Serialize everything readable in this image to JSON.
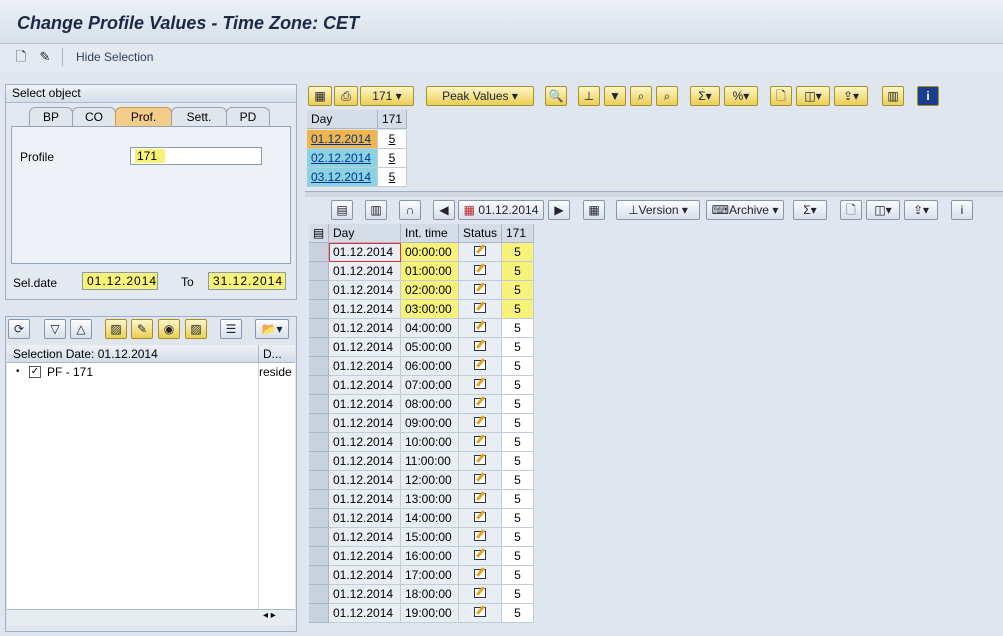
{
  "title": "Change Profile Values - Time Zone: CET",
  "appbar": {
    "hide_selection": "Hide Selection"
  },
  "select_object": {
    "header": "Select object",
    "tabs": [
      "BP",
      "CO",
      "Prof.",
      "Sett.",
      "PD"
    ],
    "active_tab": "Prof.",
    "profile_label": "Profile",
    "profile_value": "171",
    "seldate_label": "Sel.date",
    "seldate_value": "01.12.2014",
    "to_label": "To",
    "to_value": "31.12.2014"
  },
  "tree": {
    "col1": "Selection Date: 01.12.2014",
    "col2": "D...",
    "item": "PF - 171",
    "item_desc": "reside"
  },
  "top_toolbar": {
    "profile_btn": "171",
    "peak_values": "Peak Values"
  },
  "top_table": {
    "headers": [
      "Day",
      "171"
    ],
    "rows": [
      {
        "day": "01.12.2014",
        "value": "5"
      },
      {
        "day": "02.12.2014",
        "value": "5"
      },
      {
        "day": "03.12.2014",
        "value": "5"
      }
    ]
  },
  "bottom_toolbar": {
    "date_btn": "01.12.2014",
    "version": "Version",
    "archive": "Archive"
  },
  "bottom_table": {
    "headers": [
      "Day",
      "Int. time",
      "Status",
      "171"
    ],
    "rows": [
      {
        "day": "01.12.2014",
        "time": "00:00:00",
        "value": "5"
      },
      {
        "day": "01.12.2014",
        "time": "01:00:00",
        "value": "5"
      },
      {
        "day": "01.12.2014",
        "time": "02:00:00",
        "value": "5"
      },
      {
        "day": "01.12.2014",
        "time": "03:00:00",
        "value": "5"
      },
      {
        "day": "01.12.2014",
        "time": "04:00:00",
        "value": "5"
      },
      {
        "day": "01.12.2014",
        "time": "05:00:00",
        "value": "5"
      },
      {
        "day": "01.12.2014",
        "time": "06:00:00",
        "value": "5"
      },
      {
        "day": "01.12.2014",
        "time": "07:00:00",
        "value": "5"
      },
      {
        "day": "01.12.2014",
        "time": "08:00:00",
        "value": "5"
      },
      {
        "day": "01.12.2014",
        "time": "09:00:00",
        "value": "5"
      },
      {
        "day": "01.12.2014",
        "time": "10:00:00",
        "value": "5"
      },
      {
        "day": "01.12.2014",
        "time": "11:00:00",
        "value": "5"
      },
      {
        "day": "01.12.2014",
        "time": "12:00:00",
        "value": "5"
      },
      {
        "day": "01.12.2014",
        "time": "13:00:00",
        "value": "5"
      },
      {
        "day": "01.12.2014",
        "time": "14:00:00",
        "value": "5"
      },
      {
        "day": "01.12.2014",
        "time": "15:00:00",
        "value": "5"
      },
      {
        "day": "01.12.2014",
        "time": "16:00:00",
        "value": "5"
      },
      {
        "day": "01.12.2014",
        "time": "17:00:00",
        "value": "5"
      },
      {
        "day": "01.12.2014",
        "time": "18:00:00",
        "value": "5"
      },
      {
        "day": "01.12.2014",
        "time": "19:00:00",
        "value": "5"
      }
    ]
  },
  "colors": {
    "highlight": "#f6f27a",
    "active_tab": "#f4cd8b",
    "day_link_bg": "#8bd3e0",
    "day_selected_bg": "#f1b54a"
  }
}
